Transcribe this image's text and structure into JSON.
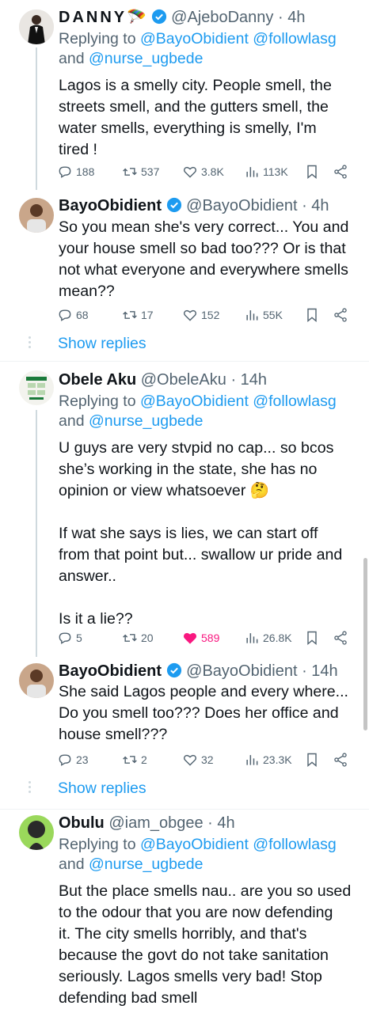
{
  "tweets": [
    {
      "name": "DANNY",
      "name_emoji": "🪂",
      "handle": "@AjeboDanny",
      "time": "· 4h",
      "replying_prefix": "Replying to",
      "replying_line1": "@BayoObidient @followlasg",
      "replying_and": "and",
      "replying_line2": "@nurse_ugbede",
      "text": "Lagos is a smelly city. People smell, the\nstreets smell, and the gutters smell, the\nwater smells, everything is smelly, I'm\ntired !",
      "replies": "188",
      "retweets": "537",
      "likes": "3.8K",
      "views": "113K"
    },
    {
      "name": "BayoObidient",
      "handle": "@BayoObidient",
      "time": "· 4h",
      "text": "So you mean she's very correct... You and\nyour house smell so bad too??? Or is that\nnot what everyone and everywhere smells\nmean??",
      "replies": "68",
      "retweets": "17",
      "likes": "152",
      "views": "55K"
    },
    {
      "name": "Obele Aku",
      "handle": "@ObeleAku",
      "time": "· 14h",
      "replying_prefix": "Replying to",
      "replying_line1": "@BayoObidient @followlasg",
      "replying_and": "and",
      "replying_line2": "@nurse_ugbede",
      "text": "U guys are very stvpid no cap... so bcos\nshe’s working in the state, she has no\nopinion or view whatsoever 🤔\n\nIf wat she says is lies, we can start off\nfrom that point but... swallow ur pride and\nanswer..\n\nIs it a lie??",
      "replies": "5",
      "retweets": "20",
      "likes": "589",
      "views": "26.8K"
    },
    {
      "name": "BayoObidient",
      "handle": "@BayoObidient",
      "time": "· 14h",
      "text": "She said Lagos people and every where...\nDo you smell too??? Does her office and\nhouse smell???",
      "replies": "23",
      "retweets": "2",
      "likes": "32",
      "views": "23.3K"
    },
    {
      "name": "Obulu",
      "handle": "@iam_obgee",
      "time": "· 4h",
      "replying_prefix": "Replying to",
      "replying_line1": "@BayoObidient @followlasg",
      "replying_and": "and",
      "replying_line2": "@nurse_ugbede",
      "text": "But the place smells nau.. are you so used\nto the odour that you are now defending\nit. The city smells horribly, and that's\nbecause the govt do not take sanitation\nseriously. Lagos smells very bad! Stop\ndefending bad smell"
    }
  ],
  "show_replies_label": "Show replies",
  "colors": {
    "accent": "#1d9bf0",
    "like_active": "#f91880",
    "muted": "#536471",
    "separator": "#eff3f4"
  }
}
